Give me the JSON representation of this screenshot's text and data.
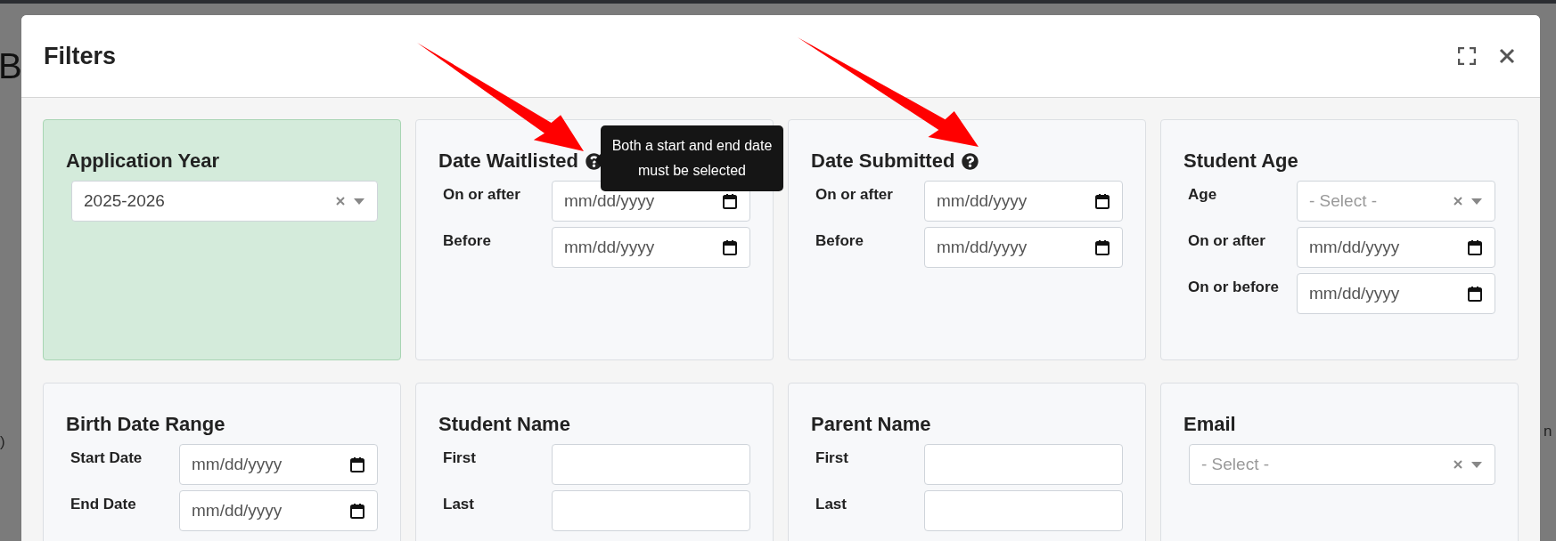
{
  "background_text": {
    "heading_fragment": "B",
    "left_fragment": ")",
    "right_fragment": "n"
  },
  "modal": {
    "title": "Filters",
    "cards": [
      {
        "title": "Application Year",
        "help": false,
        "highlighted": true,
        "fields": [
          {
            "kind": "select",
            "value": "2025-2026"
          }
        ]
      },
      {
        "title": "Date Waitlisted",
        "help": true,
        "highlighted": false,
        "tooltip": "Both a start and end date must be selected",
        "fields": [
          {
            "kind": "date",
            "label": "On or after",
            "placeholder": "mm/dd/yyyy"
          },
          {
            "kind": "date",
            "label": "Before",
            "placeholder": "mm/dd/yyyy"
          }
        ]
      },
      {
        "title": "Date Submitted",
        "help": true,
        "highlighted": false,
        "fields": [
          {
            "kind": "date",
            "label": "On or after",
            "placeholder": "mm/dd/yyyy"
          },
          {
            "kind": "date",
            "label": "Before",
            "placeholder": "mm/dd/yyyy"
          }
        ]
      },
      {
        "title": "Student Age",
        "help": false,
        "highlighted": false,
        "fields": [
          {
            "kind": "select",
            "label": "Age",
            "placeholder": "- Select -"
          },
          {
            "kind": "date",
            "label": "On or after",
            "placeholder": "mm/dd/yyyy"
          },
          {
            "kind": "date",
            "label": "On or before",
            "placeholder": "mm/dd/yyyy"
          }
        ]
      },
      {
        "title": "Birth Date Range",
        "help": false,
        "highlighted": false,
        "fields": [
          {
            "kind": "date",
            "label": "Start Date",
            "placeholder": "mm/dd/yyyy"
          },
          {
            "kind": "date",
            "label": "End Date",
            "placeholder": "mm/dd/yyyy"
          }
        ]
      },
      {
        "title": "Student Name",
        "help": false,
        "highlighted": false,
        "fields": [
          {
            "kind": "text",
            "label": "First"
          },
          {
            "kind": "text",
            "label": "Last"
          }
        ]
      },
      {
        "title": "Parent Name",
        "help": false,
        "highlighted": false,
        "fields": [
          {
            "kind": "text",
            "label": "First"
          },
          {
            "kind": "text",
            "label": "Last"
          }
        ]
      },
      {
        "title": "Email",
        "help": false,
        "highlighted": false,
        "fields": [
          {
            "kind": "select",
            "placeholder": "- Select -"
          }
        ]
      }
    ]
  }
}
